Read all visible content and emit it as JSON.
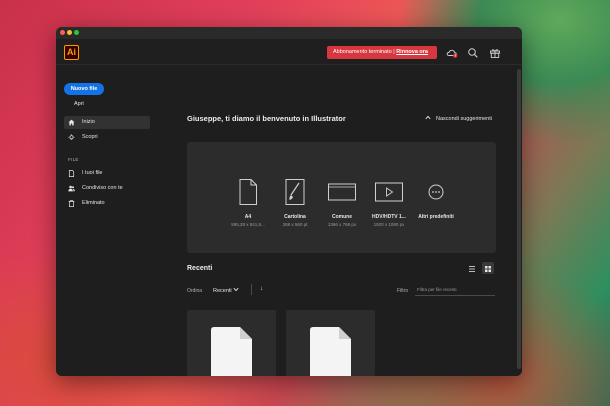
{
  "app": {
    "logo_text": "Ai",
    "accent": "#ff9a00",
    "subscription_banner": {
      "text": "Abbonamento terminato |",
      "link": "Rinnova ora",
      "color": "#d7373f"
    },
    "header_icons": [
      "cloud-alert-icon",
      "search-icon",
      "gift-icon"
    ]
  },
  "sidebar": {
    "new_file_label": "Nuovo file",
    "open_label": "Apri",
    "items": [
      {
        "label": "Inizio",
        "icon": "home-icon",
        "active": true
      },
      {
        "label": "Scopri",
        "icon": "lightbulb-icon",
        "active": false
      }
    ],
    "file_section_title": "FILE",
    "file_items": [
      {
        "label": "I tuoi file",
        "icon": "file-icon"
      },
      {
        "label": "Condiviso con te",
        "icon": "people-icon"
      },
      {
        "label": "Eliminato",
        "icon": "trash-icon"
      }
    ]
  },
  "main": {
    "welcome": "Giuseppe, ti diamo il benvenuto in Illustrator",
    "hide_suggestions": "Nascondi suggerimenti",
    "presets": [
      {
        "name": "A4",
        "size": "595,28 x 841,8...",
        "icon": "document-icon"
      },
      {
        "name": "Cartolina",
        "size": "288 x 560 pt",
        "icon": "postcard-brush-icon"
      },
      {
        "name": "Comune",
        "size": "1366 x 768 px",
        "icon": "screen-icon"
      },
      {
        "name": "HDV/HDTV 1...",
        "size": "1920 x 1080 px",
        "icon": "video-play-icon"
      },
      {
        "name": "Altri predefiniti",
        "size": "",
        "icon": "more-icon"
      }
    ],
    "recents": {
      "title": "Recenti",
      "sort_label": "Ordina",
      "sort_value": "Recenti",
      "sort_arrow": "↓",
      "filter_label": "Filtro",
      "filter_placeholder": "Filtra per file recenti",
      "views": [
        "list-view-icon",
        "grid-view-icon"
      ],
      "active_view": "grid"
    }
  }
}
